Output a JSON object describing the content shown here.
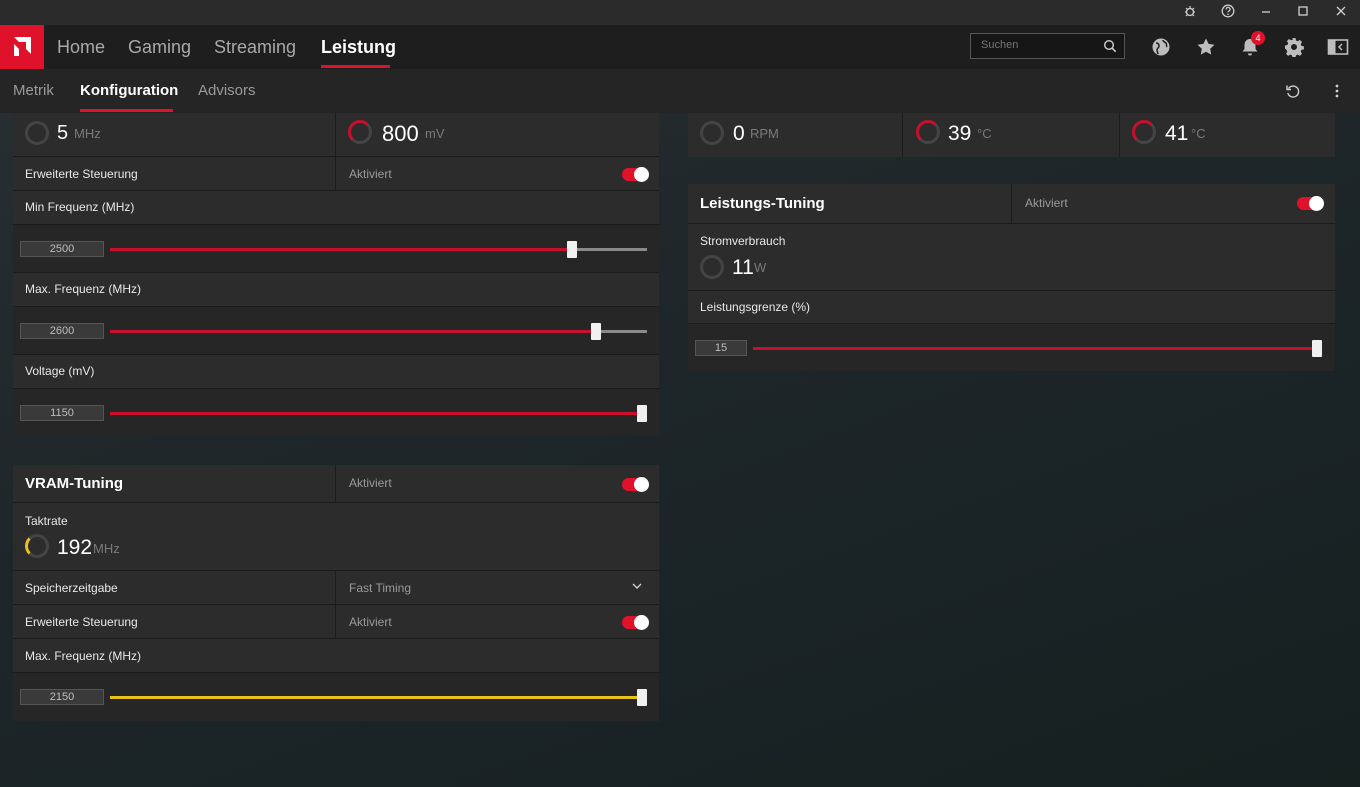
{
  "window": {
    "controls": [
      "bug-icon",
      "help-icon",
      "minimize-icon",
      "maximize-icon",
      "close-icon"
    ]
  },
  "nav": {
    "tabs": [
      "Home",
      "Gaming",
      "Streaming",
      "Leistung"
    ],
    "active": "Leistung",
    "search_placeholder": "Suchen",
    "notification_count": "4",
    "accent": "#e0112b"
  },
  "subnav": {
    "tabs": [
      "Metrik",
      "Konfiguration",
      "Advisors"
    ],
    "active": "Konfiguration"
  },
  "gpu": {
    "clock_value": "5",
    "clock_unit": "MHz",
    "voltage_value": "800",
    "voltage_unit": "mV",
    "advanced_label": "Erweiterte Steuerung",
    "advanced_state": "Aktiviert",
    "advanced_on": true,
    "min_freq_label": "Min Frequenz (MHz)",
    "min_freq_value": "2500",
    "min_freq_fraction": 0.86,
    "max_freq_label": "Max. Frequenz (MHz)",
    "max_freq_value": "2600",
    "max_freq_fraction": 0.905,
    "voltage_label": "Voltage (mV)",
    "voltage_slider_value": "1150",
    "voltage_fraction": 1.0
  },
  "vram": {
    "title": "VRAM-Tuning",
    "state": "Aktiviert",
    "on": true,
    "clock_label": "Taktrate",
    "clock_value": "192",
    "clock_unit": "MHz",
    "timing_label": "Speicherzeitgabe",
    "timing_value": "Fast Timing",
    "advanced_label": "Erweiterte Steuerung",
    "advanced_state": "Aktiviert",
    "advanced_on": true,
    "max_freq_label": "Max. Frequenz (MHz)",
    "max_freq_value": "2150",
    "max_freq_fraction": 1.0
  },
  "fan": {
    "rpm_value": "0",
    "rpm_unit": "RPM",
    "temp1_value": "39",
    "temp1_unit": "°C",
    "temp2_value": "41",
    "temp2_unit": "°C"
  },
  "power": {
    "title": "Leistungs-Tuning",
    "state": "Aktiviert",
    "on": true,
    "consumption_label": "Stromverbrauch",
    "consumption_value": "11",
    "consumption_unit": "W",
    "limit_label": "Leistungsgrenze (%)",
    "limit_value": "15",
    "limit_fraction": 1.0
  }
}
